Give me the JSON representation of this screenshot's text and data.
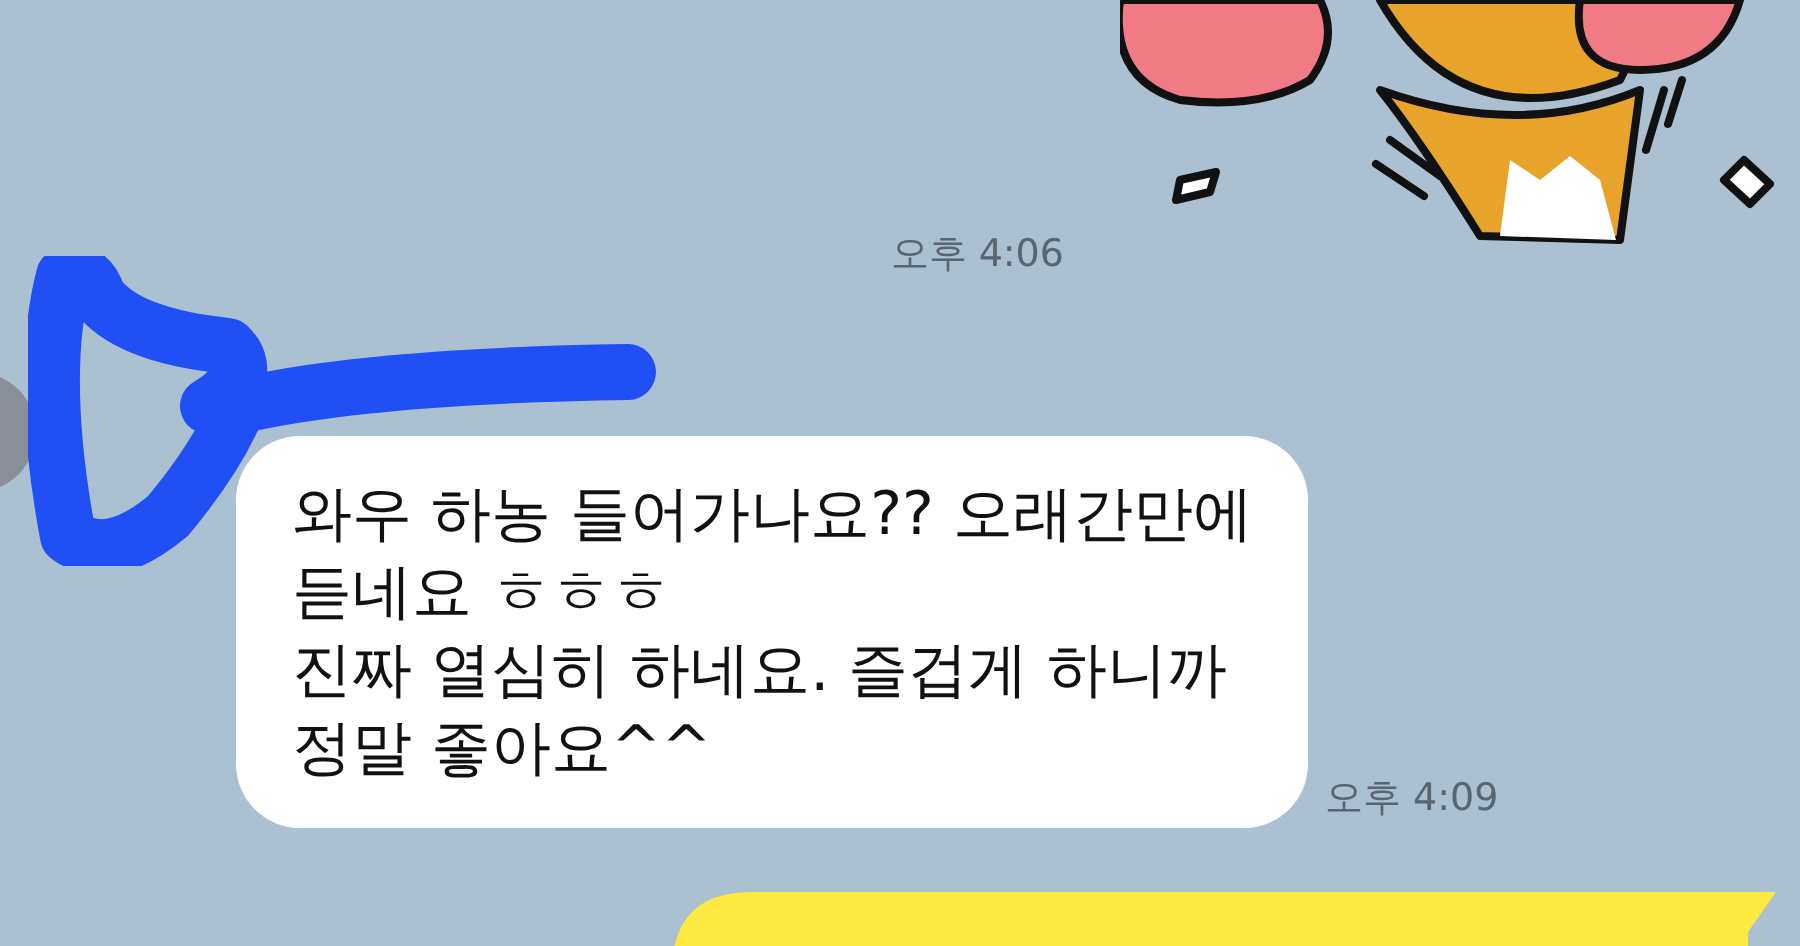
{
  "messages": [
    {
      "kind": "sticker",
      "outgoing": true,
      "time": "오후 4:06"
    },
    {
      "kind": "text",
      "outgoing": false,
      "text": "와우 하농 들어가나요?? 오래간만에\n듣네요 ㅎㅎㅎ\n진짜 열심히 하네요. 즐겁게 하니까\n정말 좋아요^^",
      "time": "오후 4:09"
    },
    {
      "kind": "text",
      "outgoing": true
    }
  ]
}
